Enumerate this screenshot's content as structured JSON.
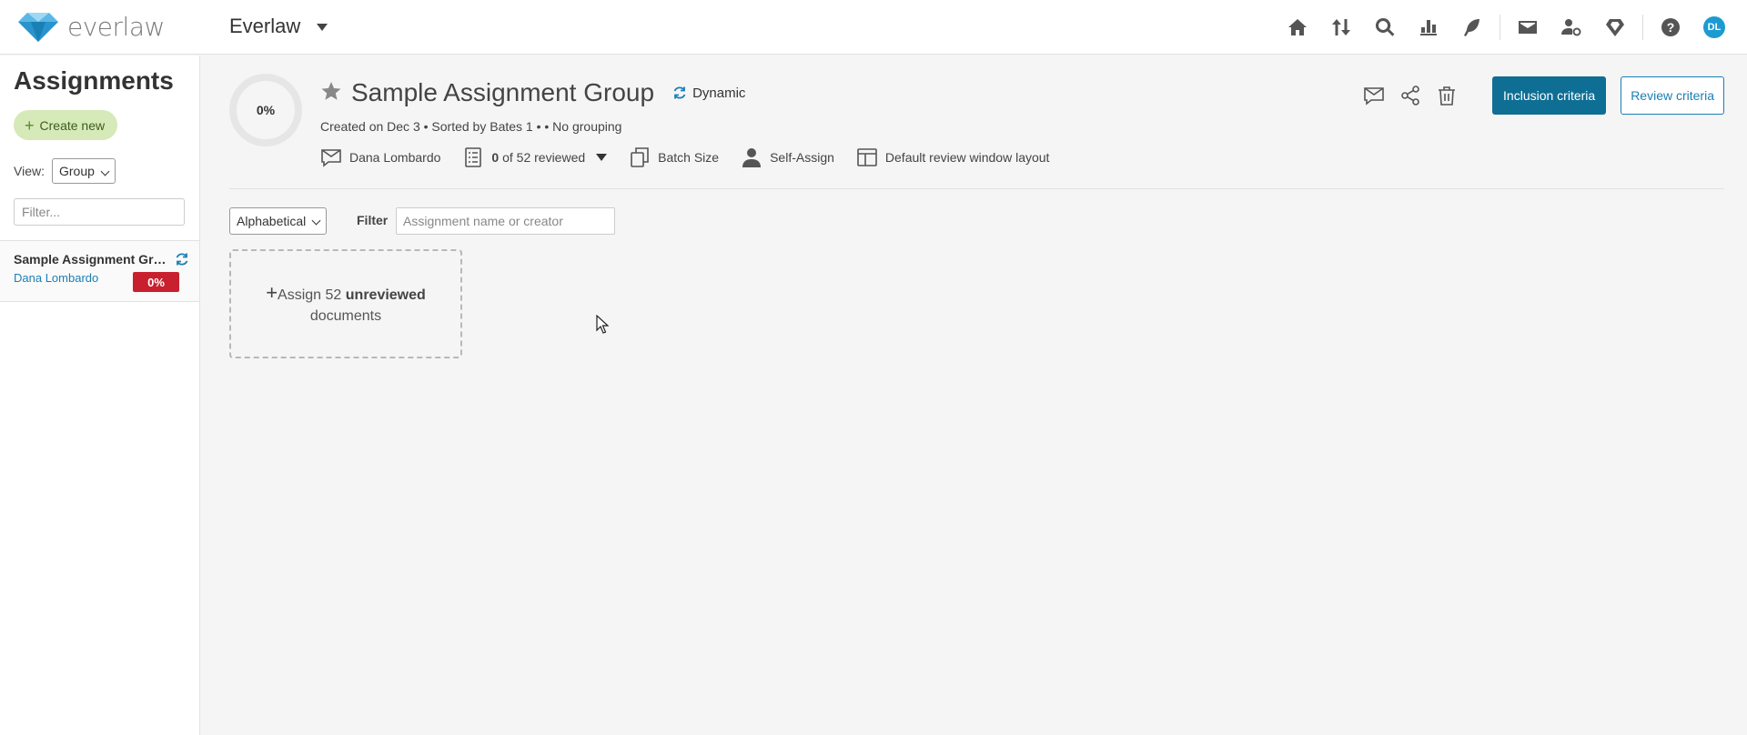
{
  "app": {
    "logo_text": "everlaw",
    "project_name": "Everlaw",
    "user_initials": "DL"
  },
  "nav": {
    "icons": [
      "home-icon",
      "sort-arrows-icon",
      "search-icon",
      "bar-chart-icon",
      "feather-pen-icon",
      "mail-icon",
      "user-settings-icon",
      "gem-icon",
      "help-icon"
    ]
  },
  "sidebar": {
    "title": "Assignments",
    "create_label": "Create new",
    "view_label": "View:",
    "view_value": "Group",
    "filter_placeholder": "Filter...",
    "items": [
      {
        "name": "Sample Assignment Group",
        "owner": "Dana Lombardo",
        "progress": "0%"
      }
    ]
  },
  "main": {
    "progress": "0%",
    "title": "Sample Assignment Group",
    "dynamic_label": "Dynamic",
    "meta": "Created on Dec 3 • Sorted by Bates 1 •  • No grouping",
    "owner": "Dana Lombardo",
    "reviewed_count": "0",
    "reviewed_suffix": " of 52 reviewed",
    "batch_size_label": "Batch Size",
    "self_assign_label": "Self-Assign",
    "layout_label": "Default review window layout",
    "inclusion_button": "Inclusion criteria",
    "review_button": "Review criteria",
    "sort_value": "Alphabetical",
    "filter_label": "Filter",
    "filter_placeholder": "Assignment name or creator",
    "assign_prefix": "Assign 52 ",
    "assign_bold": "unreviewed",
    "assign_suffix": "documents"
  },
  "colors": {
    "accent": "#0e6e94",
    "link": "#1a7fb5",
    "badge_red": "#c8202e",
    "create_green": "#d6e9b8"
  }
}
